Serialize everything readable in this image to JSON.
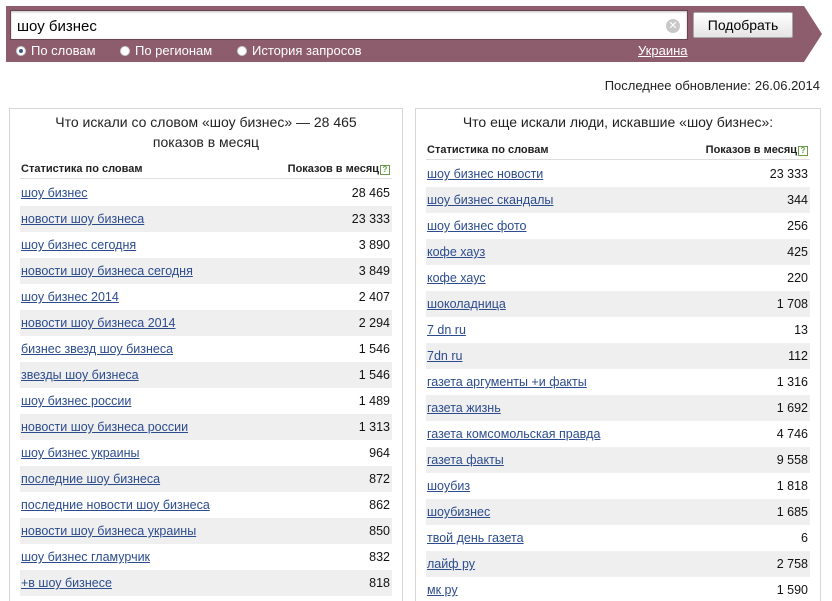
{
  "search": {
    "value": "шоу бизнес",
    "submit_label": "Подобрать",
    "clear_icon": "close-circle-icon"
  },
  "tabs": [
    {
      "label": "По словам",
      "selected": true
    },
    {
      "label": "По регионам",
      "selected": false
    },
    {
      "label": "История запросов",
      "selected": false
    }
  ],
  "region": "Украина",
  "updated": {
    "label": "Последнее обновление:",
    "date": "26.06.2014"
  },
  "left": {
    "title": "Что искали со словом «шоу бизнес» — 28 465 показов в месяц",
    "col_keyword": "Статистика по словам",
    "col_count": "Показов в месяц",
    "rows": [
      {
        "kw": "шоу бизнес",
        "cnt": "28 465"
      },
      {
        "kw": "новости шоу бизнеса",
        "cnt": "23 333"
      },
      {
        "kw": "шоу бизнес сегодня",
        "cnt": "3 890"
      },
      {
        "kw": "новости шоу бизнеса сегодня",
        "cnt": "3 849"
      },
      {
        "kw": "шоу бизнес 2014",
        "cnt": "2 407"
      },
      {
        "kw": "новости шоу бизнеса 2014",
        "cnt": "2 294"
      },
      {
        "kw": "бизнес звезд шоу бизнеса",
        "cnt": "1 546"
      },
      {
        "kw": "звезды шоу бизнеса",
        "cnt": "1 546"
      },
      {
        "kw": "шоу бизнес россии",
        "cnt": "1 489"
      },
      {
        "kw": "новости шоу бизнеса россии",
        "cnt": "1 313"
      },
      {
        "kw": "шоу бизнес украины",
        "cnt": "964"
      },
      {
        "kw": "последние шоу бизнеса",
        "cnt": "872"
      },
      {
        "kw": "последние новости шоу бизнеса",
        "cnt": "862"
      },
      {
        "kw": "новости шоу бизнеса украины",
        "cnt": "850"
      },
      {
        "kw": "шоу бизнес гламурчик",
        "cnt": "832"
      },
      {
        "kw": "+в шоу бизнесе",
        "cnt": "818"
      }
    ]
  },
  "right": {
    "title": "Что еще искали люди, искавшие «шоу бизнес»:",
    "col_keyword": "Статистика по словам",
    "col_count": "Показов в месяц",
    "rows": [
      {
        "kw": "шоу бизнес новости",
        "cnt": "23 333"
      },
      {
        "kw": "шоу бизнес скандалы",
        "cnt": "344"
      },
      {
        "kw": "шоу бизнес фото",
        "cnt": "256"
      },
      {
        "kw": "кофе хауз",
        "cnt": "425"
      },
      {
        "kw": "кофе хаус",
        "cnt": "220"
      },
      {
        "kw": "шоколадница",
        "cnt": "1 708"
      },
      {
        "kw": "7 dn ru",
        "cnt": "13"
      },
      {
        "kw": "7dn ru",
        "cnt": "112"
      },
      {
        "kw": "газета аргументы +и факты",
        "cnt": "1 316"
      },
      {
        "kw": "газета жизнь",
        "cnt": "1 692"
      },
      {
        "kw": "газета комсомольская правда",
        "cnt": "4 746"
      },
      {
        "kw": "газета факты",
        "cnt": "9 558"
      },
      {
        "kw": "шоубиз",
        "cnt": "1 818"
      },
      {
        "kw": "шоубизнес",
        "cnt": "1 685"
      },
      {
        "kw": "твой день газета",
        "cnt": "6"
      },
      {
        "kw": "лайф ру",
        "cnt": "2 758"
      },
      {
        "kw": "мк ру",
        "cnt": "1 590"
      }
    ]
  }
}
